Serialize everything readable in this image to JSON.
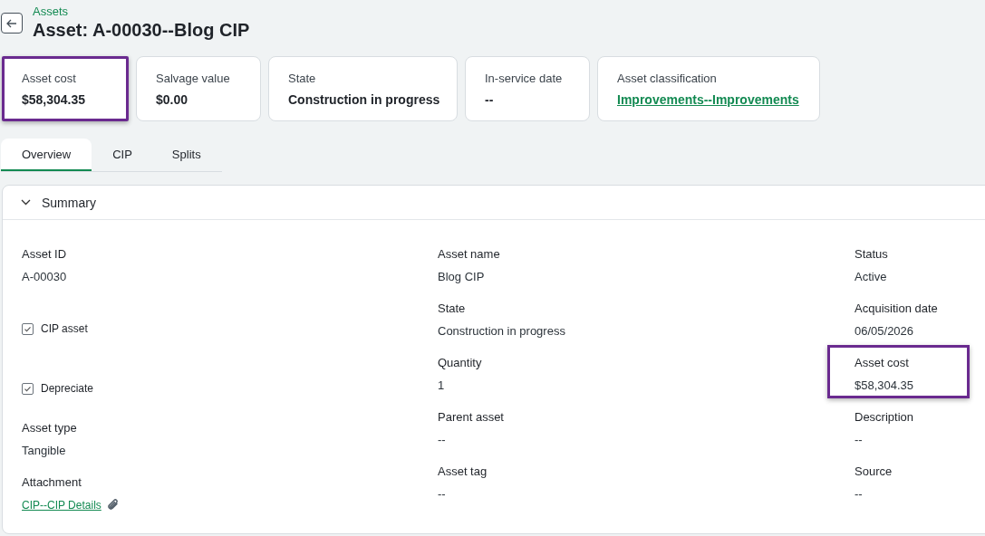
{
  "breadcrumb": "Assets",
  "title": "Asset: A-00030--Blog CIP",
  "cards": [
    {
      "label": "Asset cost",
      "value": "$58,304.35",
      "kind": "text",
      "highlighted": true
    },
    {
      "label": "Salvage value",
      "value": "$0.00",
      "kind": "text",
      "highlighted": false
    },
    {
      "label": "State",
      "value": "Construction in progress",
      "kind": "text",
      "highlighted": false
    },
    {
      "label": "In-service date",
      "value": "--",
      "kind": "text",
      "highlighted": false
    },
    {
      "label": "Asset classification",
      "value": "Improvements--Improvements",
      "kind": "link",
      "highlighted": false
    }
  ],
  "tabs": [
    {
      "label": "Overview",
      "selected": true
    },
    {
      "label": "CIP",
      "selected": false
    },
    {
      "label": "Splits",
      "selected": false
    }
  ],
  "summary": {
    "title": "Summary",
    "expanded": true,
    "columns": [
      [
        {
          "kind": "field",
          "label": "Asset ID",
          "value": "A-00030",
          "highlighted": false
        },
        {
          "kind": "checkbox",
          "label": "CIP asset",
          "checked": true
        },
        {
          "kind": "checkbox",
          "label": "Depreciate",
          "checked": true
        },
        {
          "kind": "field",
          "label": "Asset type",
          "value": "Tangible",
          "highlighted": false
        },
        {
          "kind": "link",
          "label": "Attachment",
          "value": "CIP--CIP Details"
        }
      ],
      [
        {
          "kind": "field",
          "label": "Asset name",
          "value": "Blog CIP",
          "highlighted": false
        },
        {
          "kind": "field",
          "label": "State",
          "value": "Construction in progress",
          "highlighted": false
        },
        {
          "kind": "field",
          "label": "Quantity",
          "value": "1",
          "highlighted": false
        },
        {
          "kind": "field",
          "label": "Parent asset",
          "value": "--",
          "highlighted": false
        },
        {
          "kind": "field",
          "label": "Asset tag",
          "value": "--",
          "highlighted": false
        }
      ],
      [
        {
          "kind": "field",
          "label": "Status",
          "value": "Active",
          "highlighted": false
        },
        {
          "kind": "field",
          "label": "Acquisition date",
          "value": "06/05/2026",
          "highlighted": false
        },
        {
          "kind": "field",
          "label": "Asset cost",
          "value": "$58,304.35",
          "highlighted": true
        },
        {
          "kind": "field",
          "label": "Description",
          "value": "--",
          "highlighted": false
        },
        {
          "kind": "field",
          "label": "Source",
          "value": "--",
          "highlighted": false
        }
      ]
    ]
  }
}
